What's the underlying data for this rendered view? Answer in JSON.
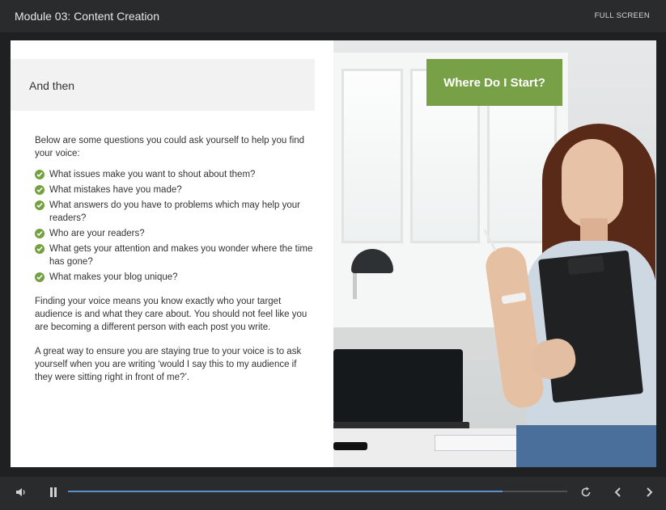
{
  "header": {
    "title": "Module 03: Content Creation",
    "fullscreen_label": "FULL SCREEN"
  },
  "slide": {
    "heading": "And then",
    "intro": "Below are some questions you could ask yourself to help you find your voice:",
    "questions": [
      "What issues make you want to shout about them?",
      "What mistakes have you made?",
      "What answers do you have to problems which may help your readers?",
      "Who are your readers?",
      "What gets your attention and makes you wonder where the time has gone?",
      "What makes your blog unique?"
    ],
    "paragraph_1": "Finding your voice means you know exactly who your target audience is and what they care about. You should not feel like you are becoming a different person with each post you write.",
    "paragraph_2": "A great way to ensure you are staying true to your voice is to ask yourself when you are writing ‘would I say this to my audience if they were sitting right in front of me?’.",
    "callout": "Where Do I Start?"
  },
  "controls": {
    "progress_fraction": 0.87,
    "icons": {
      "volume": "volume-icon",
      "pause": "pause-icon",
      "replay": "replay-icon",
      "prev": "chevron-left-icon",
      "next": "chevron-right-icon"
    }
  },
  "colors": {
    "accent_green": "#78a046",
    "progress_blue": "#5b8fd1",
    "bar_bg": "#2a2b2c"
  }
}
